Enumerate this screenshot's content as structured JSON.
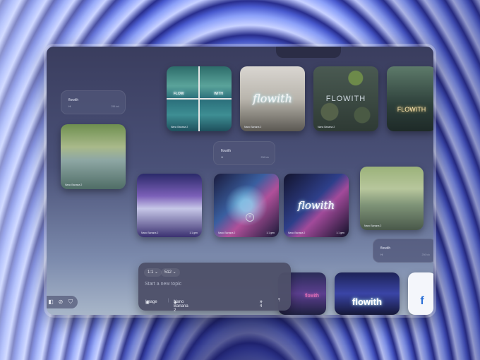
{
  "canvas": {
    "nodes": [
      {
        "id": "n1",
        "title": "flowith",
        "sub": "Hi",
        "stat": "256 tok"
      },
      {
        "id": "n2",
        "title": "flowith",
        "sub": "Hi",
        "stat": "256 tok"
      },
      {
        "id": "n3",
        "title": "flowith",
        "sub": "Hi",
        "stat": "256 tok"
      }
    ],
    "images": [
      {
        "id": "img-grid",
        "words": [
          "FLOW",
          "WITH"
        ],
        "meta": "Nano Banana 2",
        "meta_r": ""
      },
      {
        "id": "img-office",
        "word": "flowith",
        "meta": "Nano Banana 2",
        "meta_r": ""
      },
      {
        "id": "img-stones",
        "word": "FLOWITH",
        "meta": "Nano Banana 2",
        "meta_r": ""
      },
      {
        "id": "img-path",
        "word": "FLOWITH",
        "meta": "",
        "meta_r": ""
      },
      {
        "id": "img-river",
        "meta": "Nano Banana 2",
        "meta_r": ""
      },
      {
        "id": "img-crowd",
        "meta": "Nano Banana 2",
        "meta_r": "1:1 gen"
      },
      {
        "id": "img-swirl",
        "meta": "Nano Banana 2",
        "meta_r": "1:1 gen"
      },
      {
        "id": "img-swirl-text",
        "word": "flowith",
        "meta": "Nano Banana 2",
        "meta_r": "1:1 gen"
      },
      {
        "id": "img-forest",
        "meta": "Nano Banana 2",
        "meta_r": ""
      },
      {
        "id": "img-robot",
        "word": "flowith"
      },
      {
        "id": "img-city",
        "word": "flowith"
      },
      {
        "id": "img-logo",
        "word": "f"
      }
    ]
  },
  "prompt": {
    "ratio": "1:1",
    "size": "512",
    "placeholder": "Start a new topic",
    "mode": "Image",
    "model": "Nano Banana 2",
    "count": "x 4"
  },
  "colors": {
    "accent": "#6c7fd6",
    "panel": "#4e5069"
  }
}
